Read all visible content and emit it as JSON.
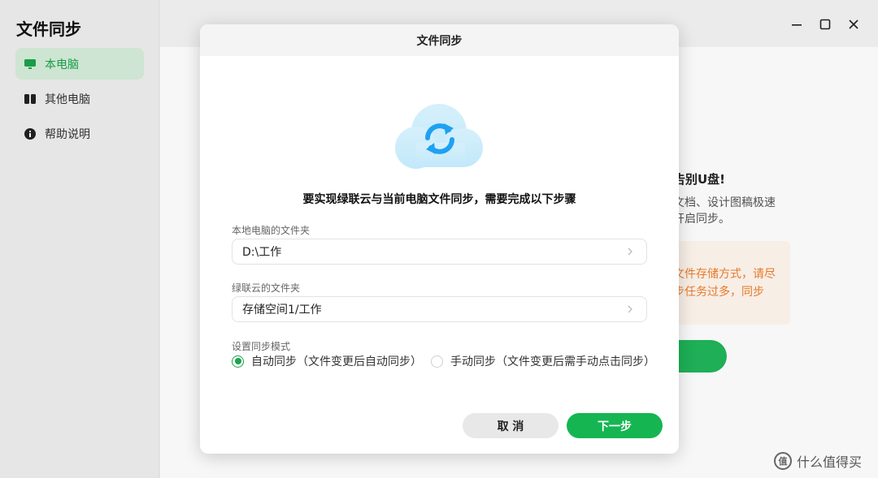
{
  "sidebar": {
    "title": "文件同步",
    "items": [
      {
        "label": "本电脑",
        "icon": "monitor-icon",
        "active": true
      },
      {
        "label": "其他电脑",
        "icon": "computers-icon",
        "active": false
      },
      {
        "label": "帮助说明",
        "icon": "info-icon",
        "active": false
      }
    ]
  },
  "background": {
    "heading": "告别U盘!",
    "text_line1": "文档、设计图稿极速",
    "text_line2": "开启同步。",
    "warning_line1": "文件存储方式，请尽",
    "warning_line2": "步任务过多，同步"
  },
  "dialog": {
    "title": "文件同步",
    "heading": "要实现绿联云与当前电脑文件同步，需要完成以下步骤",
    "local_label": "本地电脑的文件夹",
    "local_value": "D:\\工作",
    "cloud_label": "绿联云的文件夹",
    "cloud_value": "存储空间1/工作",
    "mode_label": "设置同步模式",
    "mode_auto": "自动同步（文件变更后自动同步）",
    "mode_manual": "手动同步（文件变更后需手动点击同步）",
    "selected_mode": "auto",
    "cancel_label": "取 消",
    "next_label": "下一步"
  },
  "watermark": {
    "logo_text": "值",
    "text": "什么值得买"
  },
  "colors": {
    "accent": "#1aa34a",
    "button_green": "#15b552",
    "warning": "#ef7d2a"
  }
}
